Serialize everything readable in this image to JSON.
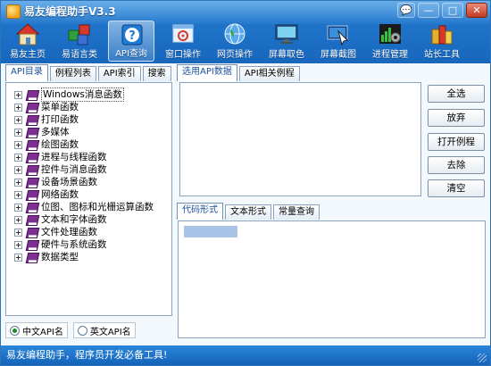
{
  "window": {
    "title": "易友编程助手V3.3",
    "controls": [
      "💬",
      "—",
      "□",
      "✕"
    ]
  },
  "toolbar": [
    {
      "label": "易友主页",
      "icon": "house-icon"
    },
    {
      "label": "易语言类",
      "icon": "cubes-icon"
    },
    {
      "label": "API查询",
      "icon": "question-icon",
      "active": true
    },
    {
      "label": "窗口操作",
      "icon": "window-target-icon"
    },
    {
      "label": "网页操作",
      "icon": "globe-icon"
    },
    {
      "label": "屏幕取色",
      "icon": "monitor-icon"
    },
    {
      "label": "屏幕截图",
      "icon": "screenshot-icon"
    },
    {
      "label": "进程管理",
      "icon": "process-gear-icon"
    },
    {
      "label": "站长工具",
      "icon": "toolbox-icon"
    }
  ],
  "left_tabs": [
    "API目录",
    "例程列表",
    "API索引",
    "搜索"
  ],
  "tree_items": [
    "Windows消息函数",
    "菜单函数",
    "打印函数",
    "多媒体",
    "绘图函数",
    "进程与线程函数",
    "控件与消息函数",
    "设备场景函数",
    "网络函数",
    "位图、图标和光栅运算函数",
    "文本和字体函数",
    "文件处理函数",
    "硬件与系统函数",
    "数据类型"
  ],
  "radio": {
    "chinese": "中文API名",
    "english": "英文API名",
    "selected": "chinese"
  },
  "right_tabs": [
    "选用API数据",
    "API相关例程"
  ],
  "buttons": {
    "select_all": "全选",
    "abandon": "放弃",
    "open_example": "打开例程",
    "remove": "去除",
    "clear": "清空"
  },
  "code_tabs": [
    "代码形式",
    "文本形式",
    "常量查询"
  ],
  "status": "易友编程助手，程序员开发必备工具!",
  "colors": {
    "title_blue": "#1f74c9",
    "status_blue": "#1563b8",
    "book_purple": "#7b2f8e",
    "active_tab_text": "#1b4f9c"
  }
}
